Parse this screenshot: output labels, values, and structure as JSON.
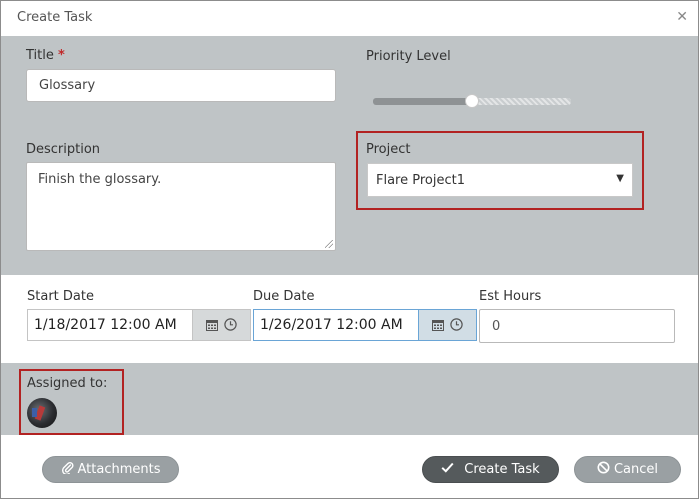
{
  "dialog": {
    "title": "Create Task"
  },
  "form": {
    "title_label": "Title",
    "title_required_marker": "*",
    "title_value": "Glossary",
    "priority_label": "Priority Level",
    "priority_value_fraction": 0.5,
    "description_label": "Description",
    "description_value": "Finish the glossary.",
    "project_label": "Project",
    "project_selected": "Flare Project1",
    "start_date_label": "Start Date",
    "start_date_value": "1/18/2017 12:00 AM",
    "due_date_label": "Due Date",
    "due_date_value": "1/26/2017 12:00 AM",
    "est_hours_label": "Est Hours",
    "est_hours_value": "0",
    "assigned_label": "Assigned to:"
  },
  "footer": {
    "attachments_label": "Attachments",
    "create_label": "Create Task",
    "cancel_label": "Cancel"
  },
  "icons": {
    "close": "close-icon",
    "calendar": "calendar-icon",
    "clock": "clock-icon",
    "paperclip": "paperclip-icon",
    "check": "check-icon",
    "cancel": "ban-icon",
    "dropdown": "caret-down-icon"
  },
  "colors": {
    "band_gray": "#bfc4c6",
    "highlight_red": "#b22222",
    "required_red": "#c0292a",
    "create_button": "#555a5c",
    "secondary_button": "#9aa0a3"
  }
}
